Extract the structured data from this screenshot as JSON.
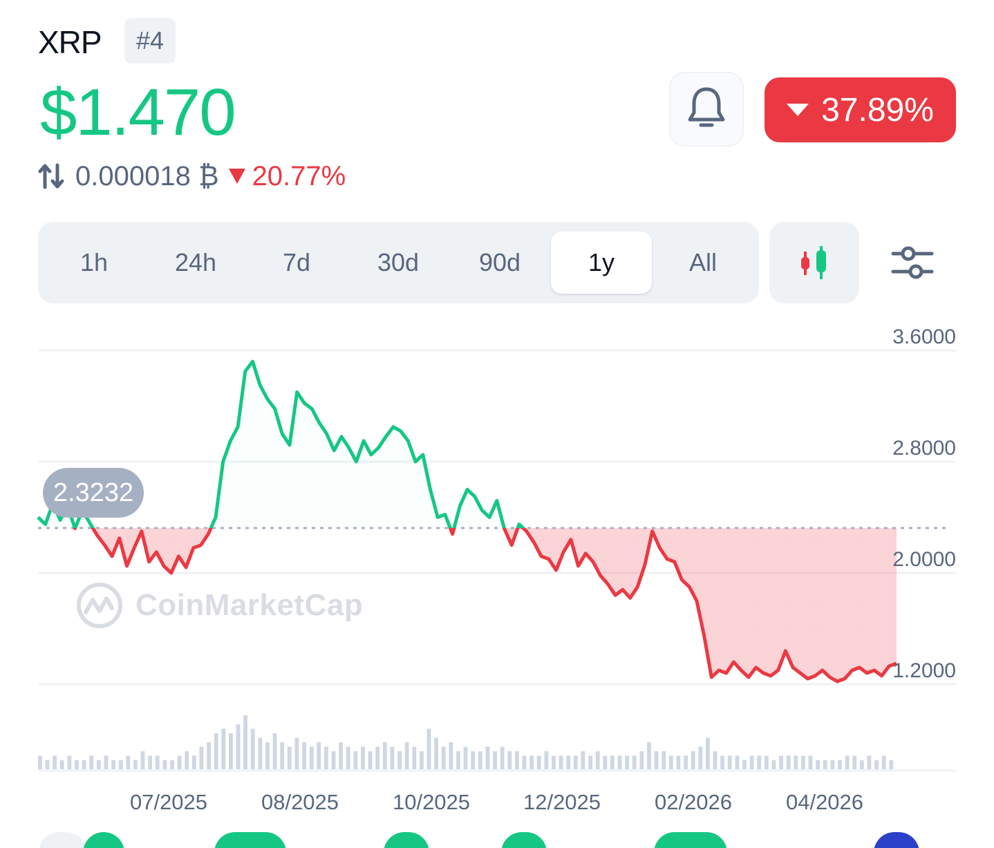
{
  "header": {
    "coin_name": "XRP",
    "rank": "#4",
    "price": "$1.470",
    "btc_value": "0.000018 ₿",
    "btc_change": "20.77%",
    "change_1y": "37.89%"
  },
  "icons": {
    "swap": "swap-arrows-icon",
    "bell": "bell-icon",
    "change_direction": "caret-down-icon",
    "candles": "candlestick-icon",
    "settings": "sliders-icon",
    "logo": "coinmarketcap-logo"
  },
  "tabs": [
    {
      "label": "1h",
      "active": false
    },
    {
      "label": "24h",
      "active": false
    },
    {
      "label": "7d",
      "active": false
    },
    {
      "label": "30d",
      "active": false
    },
    {
      "label": "90d",
      "active": false
    },
    {
      "label": "1y",
      "active": true
    },
    {
      "label": "All",
      "active": false
    }
  ],
  "watermark": "CoinMarketCap",
  "colors": {
    "up": "#16c784",
    "down": "#ea3943",
    "text_secondary": "#58667e",
    "grid": "#eff2f5",
    "volume": "#cfd6e4"
  },
  "chart_data": {
    "type": "line",
    "series": [
      {
        "values": [
          2.4,
          2.35,
          2.5,
          2.38,
          2.48,
          2.32,
          2.45,
          2.36,
          2.27,
          2.2,
          2.12,
          2.25,
          2.05,
          2.18,
          2.3,
          2.08,
          2.15,
          2.05,
          2.0,
          2.12,
          2.04,
          2.18,
          2.2,
          2.28,
          2.4,
          2.8,
          2.95,
          3.05,
          3.45,
          3.52,
          3.35,
          3.25,
          3.18,
          3.0,
          2.92,
          3.3,
          3.22,
          3.18,
          3.08,
          3.0,
          2.88,
          2.98,
          2.9,
          2.8,
          2.95,
          2.85,
          2.9,
          2.98,
          3.05,
          3.02,
          2.95,
          2.8,
          2.85,
          2.6,
          2.4,
          2.42,
          2.28,
          2.48,
          2.6,
          2.55,
          2.45,
          2.4,
          2.52,
          2.32,
          2.2,
          2.35,
          2.3,
          2.22,
          2.12,
          2.1,
          2.02,
          2.15,
          2.24,
          2.05,
          2.14,
          2.08,
          1.98,
          1.92,
          1.84,
          1.88,
          1.82,
          1.9,
          2.06,
          2.3,
          2.18,
          2.1,
          2.08,
          1.95,
          1.9,
          1.8,
          1.55,
          1.25,
          1.3,
          1.28,
          1.36,
          1.3,
          1.25,
          1.32,
          1.28,
          1.26,
          1.3,
          1.44,
          1.32,
          1.28,
          1.24,
          1.26,
          1.3,
          1.25,
          1.22,
          1.24,
          1.3,
          1.32,
          1.28,
          1.3,
          1.26,
          1.33,
          1.35
        ]
      }
    ],
    "x_labels": [
      "07/2025",
      "08/2025",
      "10/2025",
      "12/2025",
      "02/2026",
      "04/2026"
    ],
    "y_ticks": [
      "3.6000",
      "2.8000",
      "2.0000",
      "1.2000"
    ],
    "ylim": [
      1.2,
      3.6
    ],
    "reference_value": 2.3232,
    "reference_label": "2.3232",
    "up_color": "#16c784",
    "down_color": "#ea3943",
    "volume": [
      3,
      2,
      3,
      2,
      3,
      2,
      2,
      3,
      2,
      3,
      2,
      2,
      3,
      2,
      4,
      3,
      3,
      2,
      2,
      3,
      4,
      3,
      5,
      6,
      8,
      9,
      8,
      10,
      12,
      9,
      7,
      6,
      8,
      6,
      5,
      7,
      6,
      5,
      6,
      5,
      4,
      6,
      5,
      4,
      5,
      4,
      5,
      6,
      5,
      4,
      6,
      5,
      4,
      9,
      7,
      5,
      6,
      4,
      5,
      4,
      4,
      5,
      4,
      5,
      4,
      4,
      3,
      3,
      3,
      4,
      3,
      3,
      3,
      3,
      4,
      3,
      4,
      3,
      3,
      3,
      3,
      3,
      4,
      6,
      4,
      4,
      3,
      3,
      3,
      4,
      5,
      7,
      4,
      3,
      3,
      3,
      2,
      3,
      3,
      3,
      2,
      3,
      3,
      3,
      3,
      3,
      2,
      2,
      2,
      2,
      3,
      3,
      2,
      3,
      2,
      3,
      2
    ]
  }
}
